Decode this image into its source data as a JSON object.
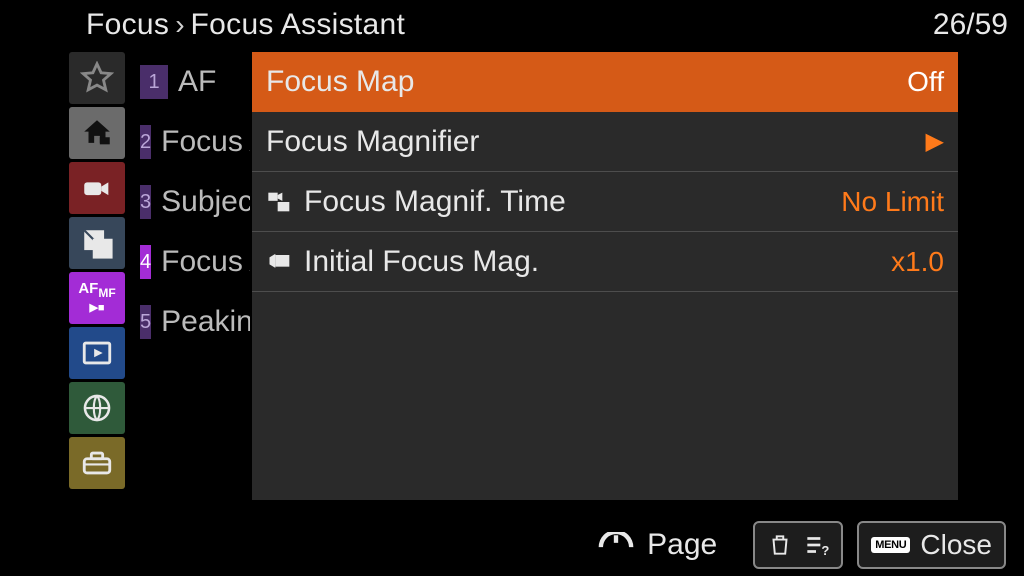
{
  "breadcrumb": {
    "root": "Focus",
    "sub": "Focus Assistant"
  },
  "page": {
    "current": 26,
    "total": 59,
    "display": "26/59"
  },
  "rail": {
    "items": [
      {
        "name": "favorites",
        "icon": "star"
      },
      {
        "name": "main",
        "icon": "home"
      },
      {
        "name": "shooting",
        "icon": "camcorder"
      },
      {
        "name": "exposure",
        "icon": "exposure"
      },
      {
        "name": "focus",
        "icon": "afmf",
        "active": true
      },
      {
        "name": "playback",
        "icon": "play"
      },
      {
        "name": "network",
        "icon": "globe"
      },
      {
        "name": "setup",
        "icon": "toolbox"
      }
    ]
  },
  "sublist": [
    {
      "num": "1",
      "label": "AF"
    },
    {
      "num": "2",
      "label": "Focus Area"
    },
    {
      "num": "3",
      "label": "Subject Recog."
    },
    {
      "num": "4",
      "label": "Focus Assistant",
      "active": true
    },
    {
      "num": "5",
      "label": "Peaking"
    }
  ],
  "settings": [
    {
      "label": "Focus Map",
      "value": "Off",
      "selected": true
    },
    {
      "label": "Focus Magnifier",
      "arrow": true
    },
    {
      "label": "Focus Magnif. Time",
      "value": "No Limit",
      "icon": "movie-still"
    },
    {
      "label": "Initial Focus Mag.",
      "value": "x1.0",
      "icon": "movie"
    }
  ],
  "footer": {
    "page_label": "Page",
    "close_label": "Close",
    "menu_badge": "MENU"
  }
}
